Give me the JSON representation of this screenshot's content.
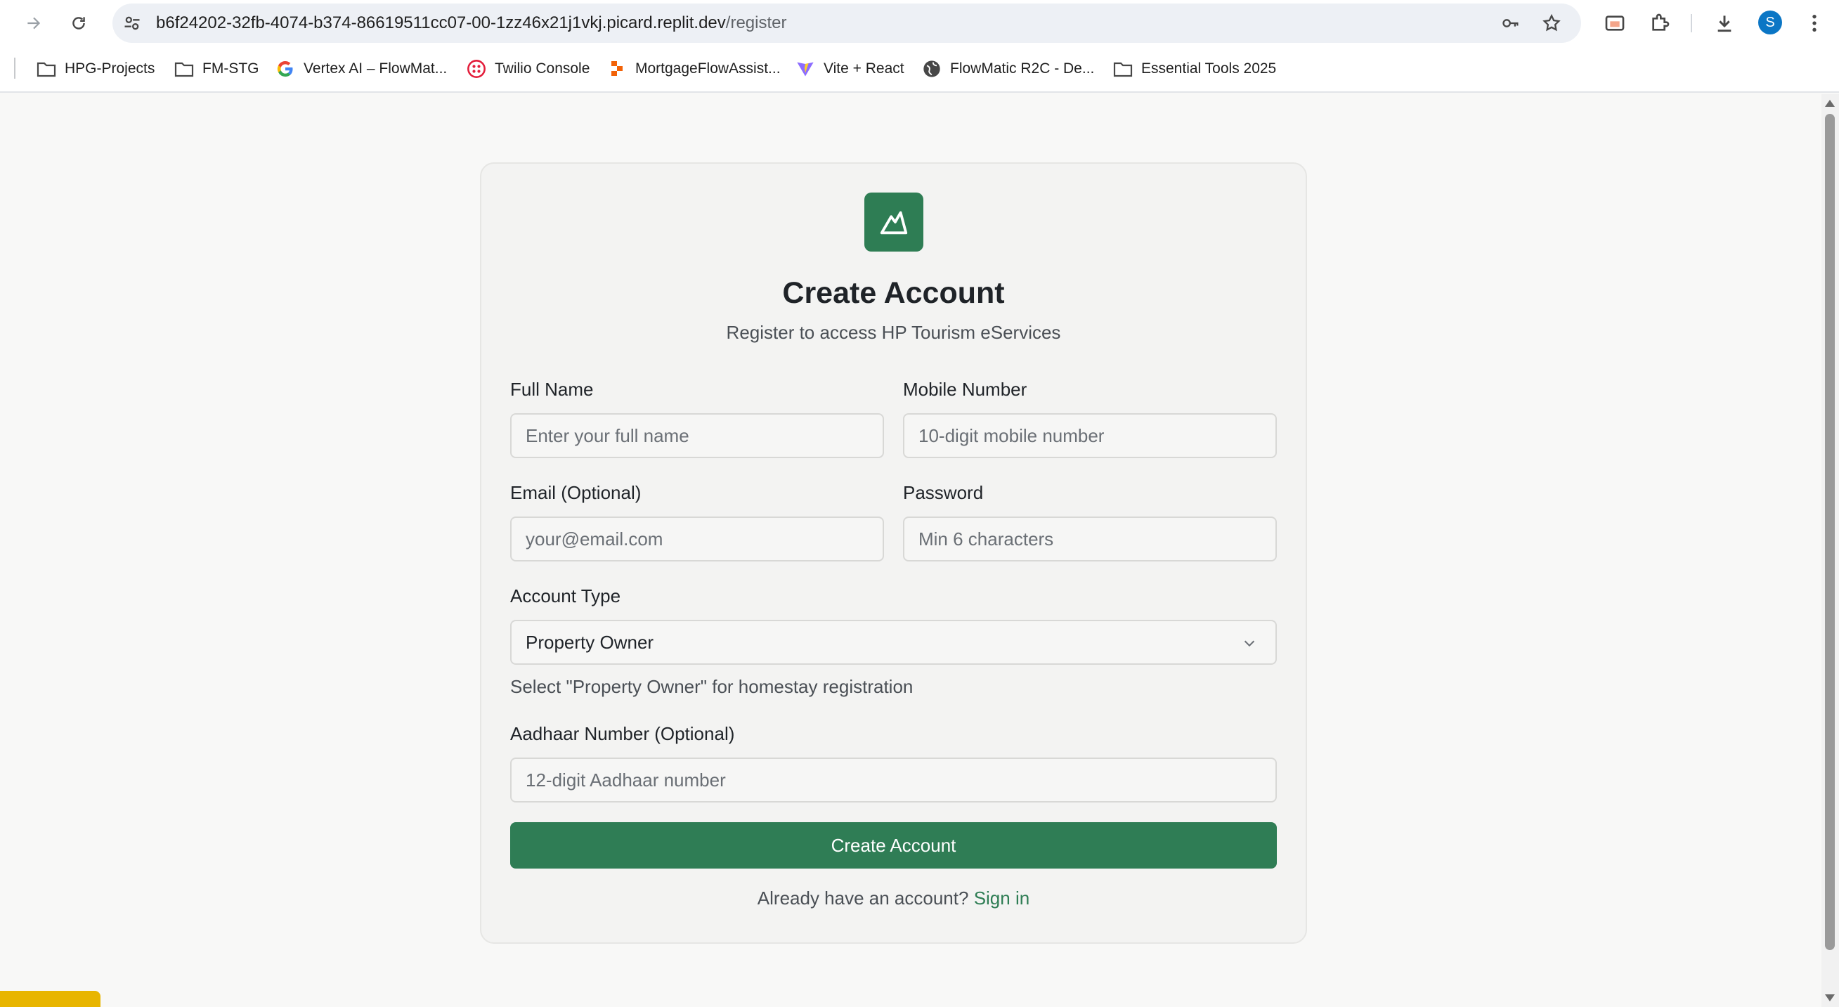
{
  "browser": {
    "url_host": "b6f24202-32fb-4074-b374-86619511cc07-00-1zz46x21j1vkj.picard.replit.dev",
    "url_path": "/register",
    "avatar_letter": "S",
    "bookmarks": [
      {
        "label": "HPG-Projects",
        "icon": "folder-icon"
      },
      {
        "label": "FM-STG",
        "icon": "folder-icon"
      },
      {
        "label": "Vertex AI – FlowMat...",
        "icon": "google-icon"
      },
      {
        "label": "Twilio Console",
        "icon": "twilio-icon"
      },
      {
        "label": "MortgageFlowAssist...",
        "icon": "replit-icon"
      },
      {
        "label": "Vite + React",
        "icon": "vite-icon"
      },
      {
        "label": "FlowMatic R2C - De...",
        "icon": "globe-icon"
      },
      {
        "label": "Essential Tools 2025",
        "icon": "folder-icon"
      }
    ]
  },
  "form": {
    "title": "Create Account",
    "subtitle": "Register to access HP Tourism eServices",
    "full_name": {
      "label": "Full Name",
      "placeholder": "Enter your full name",
      "value": ""
    },
    "mobile": {
      "label": "Mobile Number",
      "placeholder": "10-digit mobile number",
      "value": ""
    },
    "email": {
      "label": "Email (Optional)",
      "placeholder": "your@email.com",
      "value": ""
    },
    "password": {
      "label": "Password",
      "placeholder": "Min 6 characters",
      "value": ""
    },
    "account_type": {
      "label": "Account Type",
      "selected": "Property Owner",
      "hint": "Select \"Property Owner\" for homestay registration"
    },
    "aadhaar": {
      "label": "Aadhaar Number (Optional)",
      "placeholder": "12-digit Aadhaar number",
      "value": ""
    },
    "submit_label": "Create Account",
    "signin_prompt": "Already have an account?",
    "signin_link": "Sign in"
  },
  "colors": {
    "accent": "#2e7d54",
    "page_bg": "#f8f8f7",
    "card_bg": "#f3f3f2"
  }
}
